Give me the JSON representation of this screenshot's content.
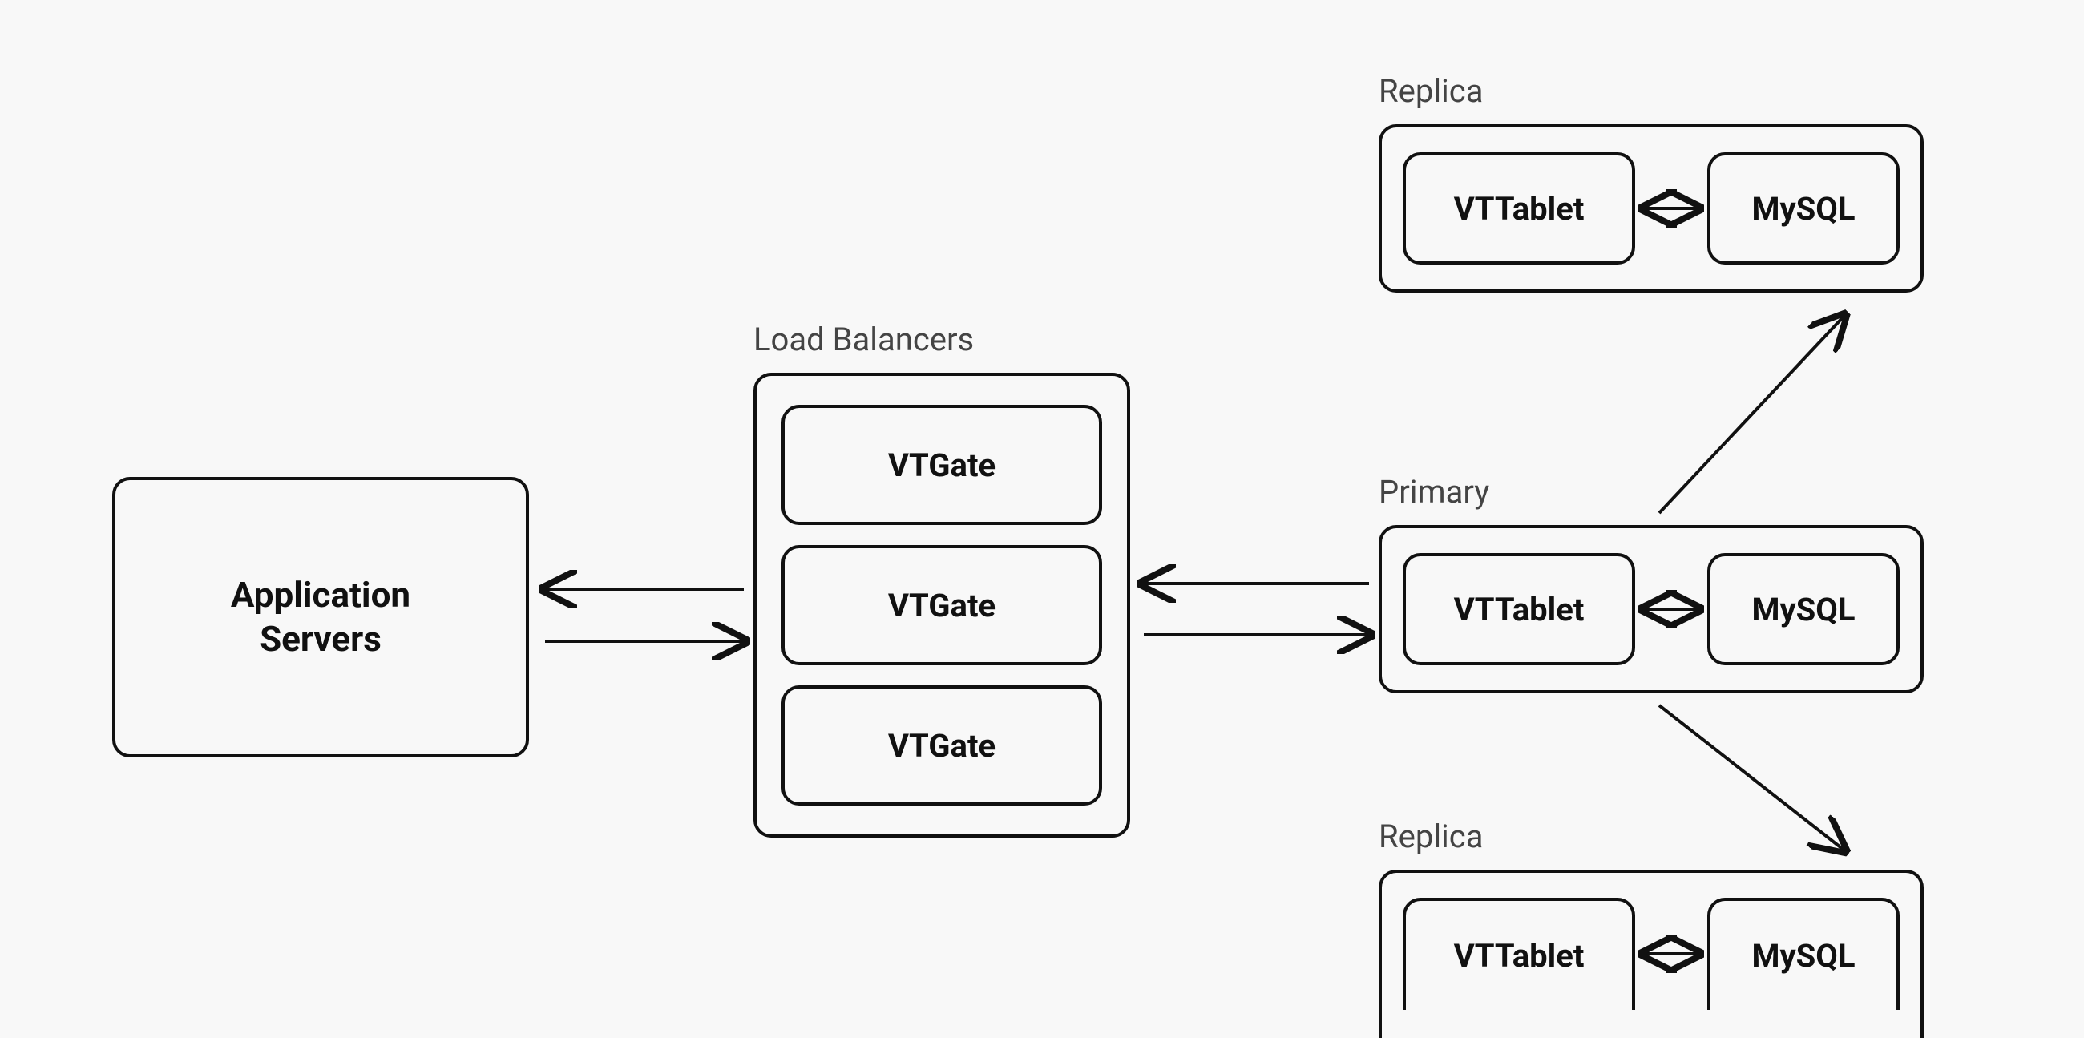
{
  "app_servers": {
    "label": "Application\nServers"
  },
  "load_balancers": {
    "title": "Load Balancers",
    "gates": [
      "VTGate",
      "VTGate",
      "VTGate"
    ]
  },
  "primary": {
    "title": "Primary",
    "tablet": "VTTablet",
    "db": "MySQL"
  },
  "replicas": [
    {
      "title": "Replica",
      "tablet": "VTTablet",
      "db": "MySQL"
    },
    {
      "title": "Replica",
      "tablet": "VTTablet",
      "db": "MySQL"
    }
  ]
}
